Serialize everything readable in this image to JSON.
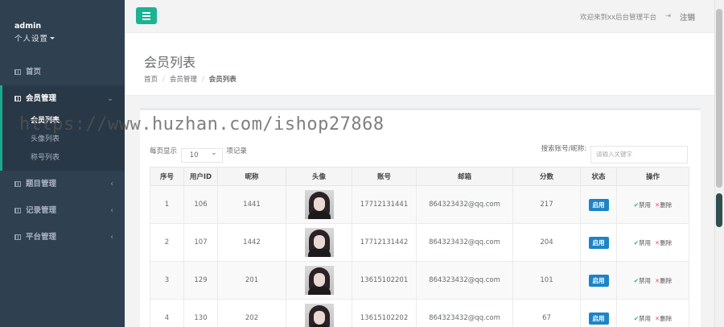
{
  "sidebar": {
    "profile_name": "admin",
    "profile_settings": "个人设置",
    "home_label": "首页",
    "member_group": {
      "label": "会员管理",
      "items": [
        "会员列表",
        "头像列表",
        "称号列表"
      ]
    },
    "groups": [
      "题目管理",
      "记录管理",
      "平台管理"
    ]
  },
  "topbar": {
    "welcome": "欢迎来到xx后台管理平台",
    "logout": "注销"
  },
  "heading": {
    "title": "会员列表",
    "breadcrumb": [
      "首页",
      "会员管理",
      "会员列表"
    ]
  },
  "watermark": "https://www.huzhan.com/ishop27868",
  "list": {
    "per_page_prefix": "每页显示",
    "per_page_value": "10",
    "per_page_suffix": "项记录",
    "search_label": "搜索账号/昵称:",
    "search_placeholder": "请输入关键字",
    "columns": [
      "序号",
      "用户ID",
      "昵称",
      "头像",
      "账号",
      "邮箱",
      "分数",
      "状态",
      "操作"
    ],
    "rows": [
      {
        "no": "1",
        "uid": "106",
        "nick": "1441",
        "account": "17712131441",
        "email": "864323432@qq.com",
        "score": "217",
        "status": "启用"
      },
      {
        "no": "2",
        "uid": "107",
        "nick": "1442",
        "account": "17712131442",
        "email": "864323432@qq.com",
        "score": "204",
        "status": "启用"
      },
      {
        "no": "3",
        "uid": "129",
        "nick": "201",
        "account": "13615102201",
        "email": "864323432@qq.com",
        "score": "101",
        "status": "启用"
      },
      {
        "no": "4",
        "uid": "130",
        "nick": "202",
        "account": "13615102202",
        "email": "864323432@qq.com",
        "score": "67",
        "status": "启用"
      }
    ],
    "action_disable": "禁用",
    "action_delete": "删除"
  },
  "colors": {
    "sidebar_bg": "#2f4050",
    "accent": "#1ab394",
    "status_badge": "#1c84c6"
  }
}
